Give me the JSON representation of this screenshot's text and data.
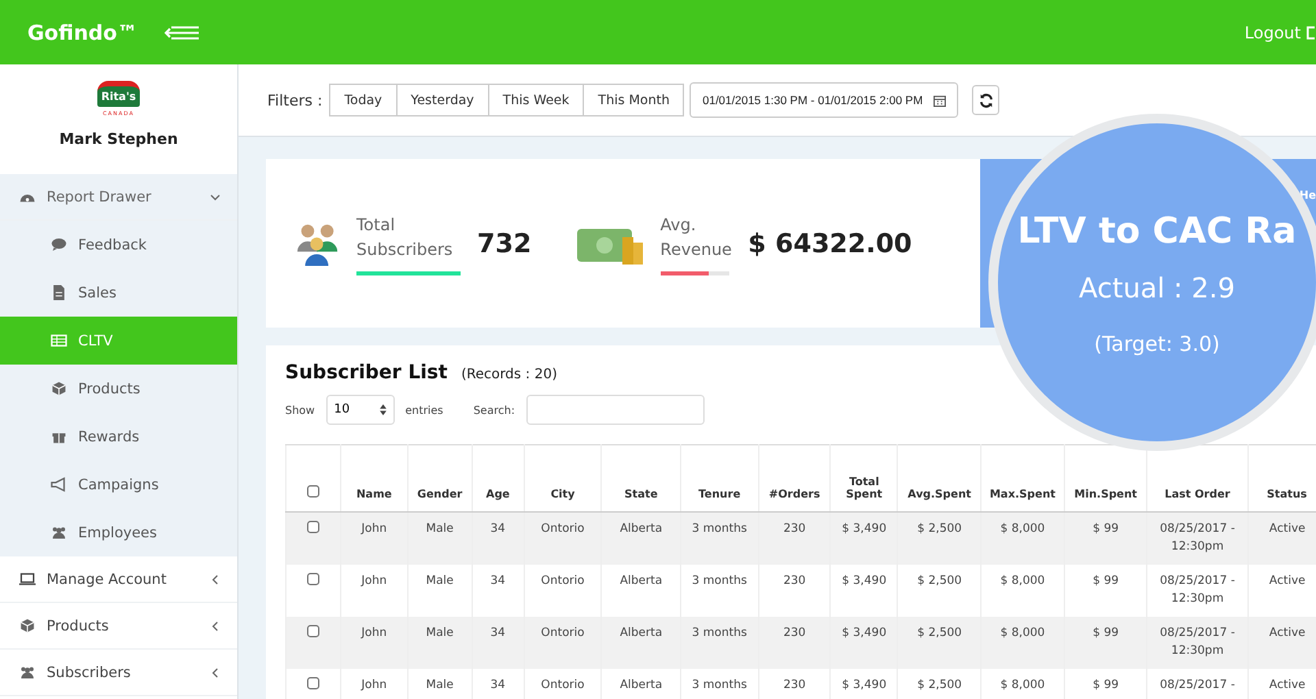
{
  "header": {
    "brand": "Gofindo™",
    "logout": "Logout"
  },
  "sidebar": {
    "logo": {
      "name": "Rita's",
      "sub": "CANADA"
    },
    "user": "Mark Stephen",
    "items": [
      {
        "label": "Report Drawer",
        "kind": "dashboard",
        "expanded": true,
        "children": [
          {
            "label": "Feedback",
            "kind": "comment",
            "selected": false
          },
          {
            "label": "Sales",
            "kind": "file",
            "selected": false
          },
          {
            "label": "CLTV",
            "kind": "table",
            "selected": true
          },
          {
            "label": "Products",
            "kind": "cube",
            "selected": false
          },
          {
            "label": "Rewards",
            "kind": "gift",
            "selected": false
          },
          {
            "label": "Campaigns",
            "kind": "bullhorn",
            "selected": false
          },
          {
            "label": "Employees",
            "kind": "users",
            "selected": false
          }
        ]
      },
      {
        "label": "Manage Account",
        "kind": "laptop",
        "expanded": false
      },
      {
        "label": "Products",
        "kind": "cube",
        "expanded": false
      },
      {
        "label": "Subscribers",
        "kind": "users",
        "expanded": false
      }
    ]
  },
  "filters": {
    "label": "Filters :",
    "buttons": [
      "Today",
      "Yesterday",
      "This Week",
      "This Month"
    ],
    "date_range": "01/01/2015 1:30 PM - 01/01/2015 2:00 PM"
  },
  "stats": [
    {
      "label": "Total Subscribers",
      "value": "732",
      "kind": "people",
      "level": 1,
      "color": "#22e39a"
    },
    {
      "label": "Avg. Revenue",
      "value": "$ 64322.00",
      "kind": "money",
      "level": 0.7,
      "color": "#f25c6b"
    }
  ],
  "ratio_panel": {
    "help": "He",
    "title": "LTV to CAC Ra",
    "actual": "Actual : 2.9",
    "target": "(Target: 3.0)"
  },
  "subscriber_list": {
    "title": "Subscriber List",
    "records": "(Records : 20)",
    "show_label": "Show",
    "page_size": "10",
    "entries_label": "entries",
    "search_label": "Search:",
    "select_all_checked": false,
    "columns": [
      "Name",
      "Gender",
      "Age",
      "City",
      "State",
      "Tenure",
      "#Orders",
      "Total Spent",
      "Avg.Spent",
      "Max.Spent",
      "Min.Spent",
      "Last Order",
      "Status"
    ],
    "rows": [
      {
        "checked": false,
        "cells": [
          "John",
          "Male",
          "34",
          "Ontorio",
          "Alberta",
          "3 months",
          "230",
          "$ 3,490",
          "$ 2,500",
          "$ 8,000",
          "$ 99",
          "08/25/2017 - 12:30pm",
          "Active"
        ]
      },
      {
        "checked": false,
        "cells": [
          "John",
          "Male",
          "34",
          "Ontorio",
          "Alberta",
          "3 months",
          "230",
          "$ 3,490",
          "$ 2,500",
          "$ 8,000",
          "$ 99",
          "08/25/2017 - 12:30pm",
          "Active"
        ]
      },
      {
        "checked": false,
        "cells": [
          "John",
          "Male",
          "34",
          "Ontorio",
          "Alberta",
          "3 months",
          "230",
          "$ 3,490",
          "$ 2,500",
          "$ 8,000",
          "$ 99",
          "08/25/2017 - 12:30pm",
          "Active"
        ]
      },
      {
        "checked": false,
        "cells": [
          "John",
          "Male",
          "34",
          "Ontorio",
          "Alberta",
          "3 months",
          "230",
          "$ 3,490",
          "$ 2,500",
          "$ 8,000",
          "$ 99",
          "08/25/2017 -",
          "Active"
        ]
      }
    ]
  }
}
